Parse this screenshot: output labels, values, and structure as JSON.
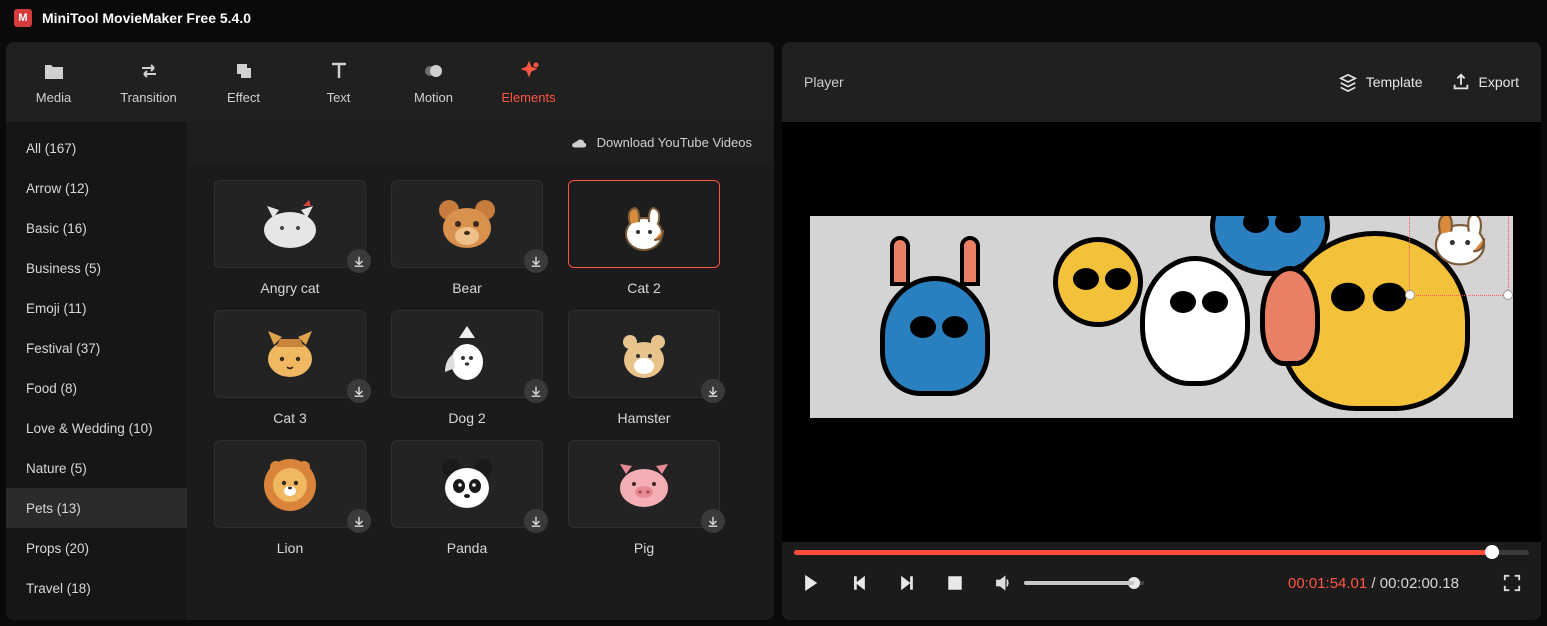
{
  "app": {
    "title": "MiniTool MovieMaker Free 5.4.0"
  },
  "toolbar": [
    {
      "id": "media",
      "label": "Media"
    },
    {
      "id": "transition",
      "label": "Transition"
    },
    {
      "id": "effect",
      "label": "Effect"
    },
    {
      "id": "text",
      "label": "Text"
    },
    {
      "id": "motion",
      "label": "Motion"
    },
    {
      "id": "elements",
      "label": "Elements",
      "active": true
    }
  ],
  "categories": [
    {
      "label": "All (167)"
    },
    {
      "label": "Arrow (12)"
    },
    {
      "label": "Basic (16)"
    },
    {
      "label": "Business (5)"
    },
    {
      "label": "Emoji (11)"
    },
    {
      "label": "Festival (37)"
    },
    {
      "label": "Food (8)"
    },
    {
      "label": "Love & Wedding (10)"
    },
    {
      "label": "Nature (5)"
    },
    {
      "label": "Pets (13)",
      "active": true
    },
    {
      "label": "Props (20)"
    },
    {
      "label": "Travel (18)"
    }
  ],
  "assets_header": {
    "download_yt": "Download YouTube Videos"
  },
  "assets": [
    {
      "label": "Angry cat",
      "downloadable": true
    },
    {
      "label": "Bear",
      "downloadable": true
    },
    {
      "label": "Cat 2",
      "downloadable": false,
      "selected": true
    },
    {
      "label": "Cat 3",
      "downloadable": true
    },
    {
      "label": "Dog 2",
      "downloadable": true
    },
    {
      "label": "Hamster",
      "downloadable": true
    },
    {
      "label": "Lion",
      "downloadable": true
    },
    {
      "label": "Panda",
      "downloadable": true
    },
    {
      "label": "Pig",
      "downloadable": true
    }
  ],
  "player": {
    "title": "Player",
    "template_label": "Template",
    "export_label": "Export",
    "time_current": "00:01:54.01",
    "time_total": "00:02:00.18",
    "time_sep": " / ",
    "progress_pct": 95,
    "volume_pct": 92
  },
  "colors": {
    "accent": "#ff5544"
  }
}
